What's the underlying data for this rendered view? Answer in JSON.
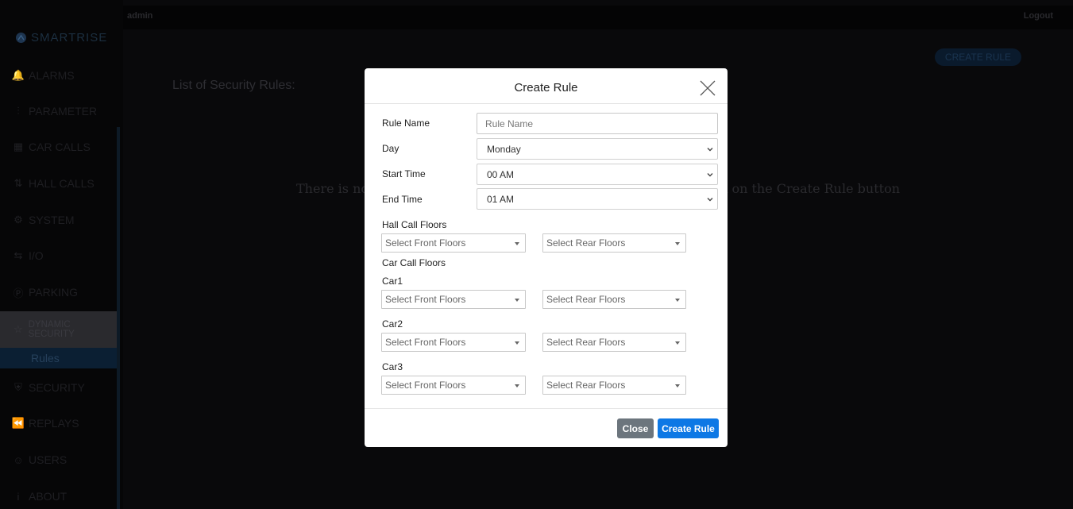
{
  "topbar": {
    "user": "admin",
    "logout": "Logout"
  },
  "sidebar": {
    "brand": "SMARTRISE",
    "items": [
      {
        "label": "ALARMS",
        "icon": "bell-icon"
      },
      {
        "label": "PARAMETER",
        "icon": "sliders-icon"
      },
      {
        "label": "CAR CALLS",
        "icon": "keypad-icon"
      },
      {
        "label": "HALL CALLS",
        "icon": "up-down-icon"
      },
      {
        "label": "SYSTEM",
        "icon": "gear-icon"
      },
      {
        "label": "I/O",
        "icon": "arrows-icon"
      },
      {
        "label": "PARKING",
        "icon": "parking-icon"
      },
      {
        "label": "DYNAMIC SECURITY",
        "icon": "star-icon"
      },
      {
        "label": "SECURITY",
        "icon": "shield-icon"
      },
      {
        "label": "REPLAYS",
        "icon": "rewind-icon"
      },
      {
        "label": "USERS",
        "icon": "users-icon"
      },
      {
        "label": "ABOUT",
        "icon": "info-icon"
      }
    ],
    "sub_item": "Rules"
  },
  "main": {
    "create_rule_button": "CREATE RULE",
    "list_title": "List of Security Rules:",
    "empty_left": "There is no",
    "empty_right": "k on the Create Rule button"
  },
  "modal": {
    "title": "Create Rule",
    "rule_name_label": "Rule Name",
    "rule_name_placeholder": "Rule Name",
    "rule_name_value": "",
    "day_label": "Day",
    "day_value": "Monday",
    "start_label": "Start Time",
    "start_value": "00 AM",
    "end_label": "End Time",
    "end_value": "01 AM",
    "hall_call_label": "Hall Call Floors",
    "car_call_label": "Car Call Floors",
    "front_placeholder": "Select Front Floors",
    "rear_placeholder": "Select Rear Floors",
    "cars": [
      "Car1",
      "Car2",
      "Car3"
    ],
    "close_button": "Close",
    "create_button": "Create Rule"
  },
  "colors": {
    "primary": "#0d78e5",
    "secondary": "#6c757d"
  }
}
